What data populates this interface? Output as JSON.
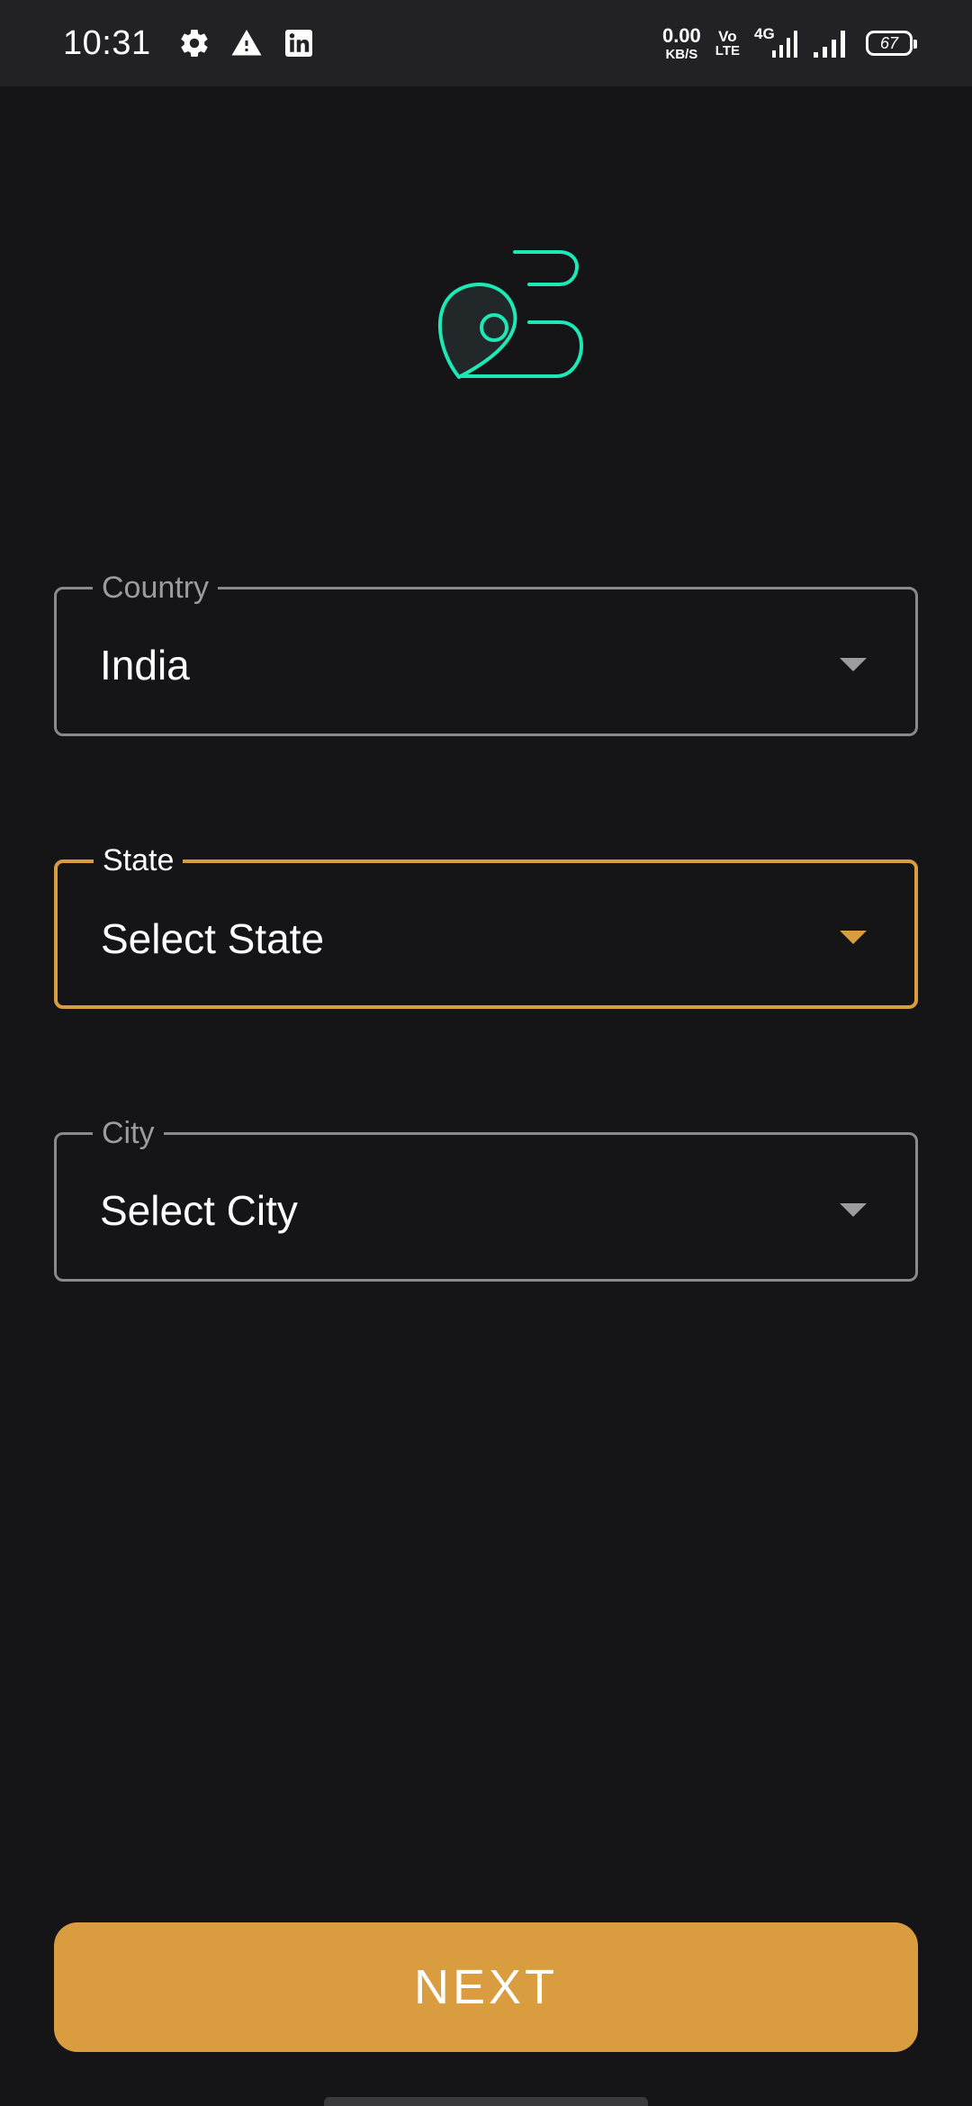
{
  "status_bar": {
    "time": "10:31",
    "net_speed_value": "0.00",
    "net_speed_unit": "KB/S",
    "volte_top": "Vo",
    "volte_bottom": "LTE",
    "network_type": "4G",
    "battery_level": "67",
    "icons": [
      "gear-icon",
      "warning-icon",
      "linkedin-icon",
      "signal-4g-icon",
      "signal-icon",
      "battery-icon"
    ]
  },
  "logo": {
    "icon": "location-route-icon",
    "color": "#1de9b6"
  },
  "form": {
    "country": {
      "label": "Country",
      "value": "India"
    },
    "state": {
      "label": "State",
      "value": "Select State"
    },
    "city": {
      "label": "City",
      "value": "Select City"
    }
  },
  "next_button": {
    "label": "NEXT"
  },
  "colors": {
    "background": "#151517",
    "accent": "#d99d3f",
    "logo": "#1de9b6",
    "border": "#8a8a8e"
  }
}
